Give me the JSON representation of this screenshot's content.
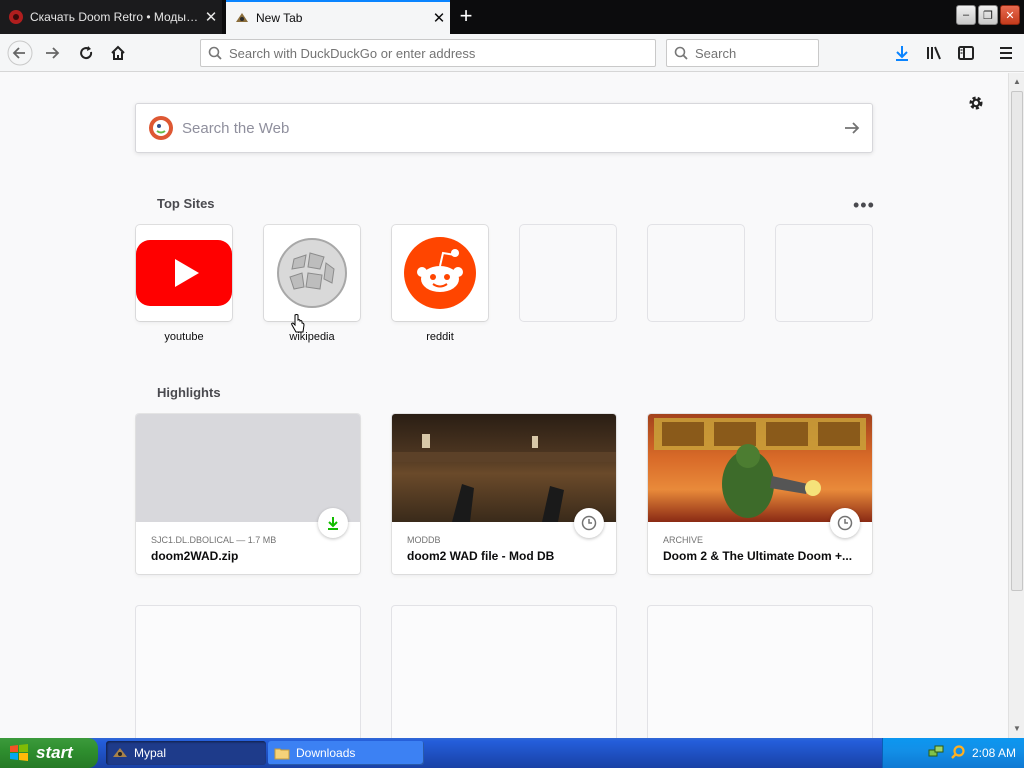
{
  "tabs": [
    {
      "title": "Скачать Doom Retro • Моды и у",
      "active": false
    },
    {
      "title": "New Tab",
      "active": true
    }
  ],
  "navbar": {
    "url_placeholder": "Search with DuckDuckGo or enter address",
    "search_placeholder": "Search"
  },
  "page": {
    "websearch_placeholder": "Search the Web",
    "top_sites_title": "Top Sites",
    "top_sites": [
      {
        "label": "youtube",
        "icon": "youtube-logo"
      },
      {
        "label": "wikipedia",
        "icon": "wikipedia-logo"
      },
      {
        "label": "reddit",
        "icon": "reddit-logo"
      },
      {
        "label": "",
        "icon": ""
      },
      {
        "label": "",
        "icon": ""
      },
      {
        "label": "",
        "icon": ""
      }
    ],
    "highlights_title": "Highlights",
    "highlights": [
      {
        "source": "SJC1.DL.DBOLICAL — 1.7 MB",
        "title": "doom2WAD.zip",
        "badge": "download-icon"
      },
      {
        "source": "MODDB",
        "title": "doom2 WAD file - Mod DB",
        "badge": "clock-icon"
      },
      {
        "source": "ARCHIVE",
        "title": "Doom 2 & The Ultimate Doom +...",
        "badge": "clock-icon"
      }
    ]
  },
  "taskbar": {
    "start_label": "start",
    "items": [
      {
        "label": "Mypal",
        "active": true
      },
      {
        "label": "Downloads",
        "active": false
      }
    ],
    "clock": "2:08 AM"
  },
  "colors": {
    "accent": "#0a84ff",
    "youtube_red": "#ff0000",
    "reddit_orange": "#ff4500",
    "download_green": "#12bc00"
  }
}
